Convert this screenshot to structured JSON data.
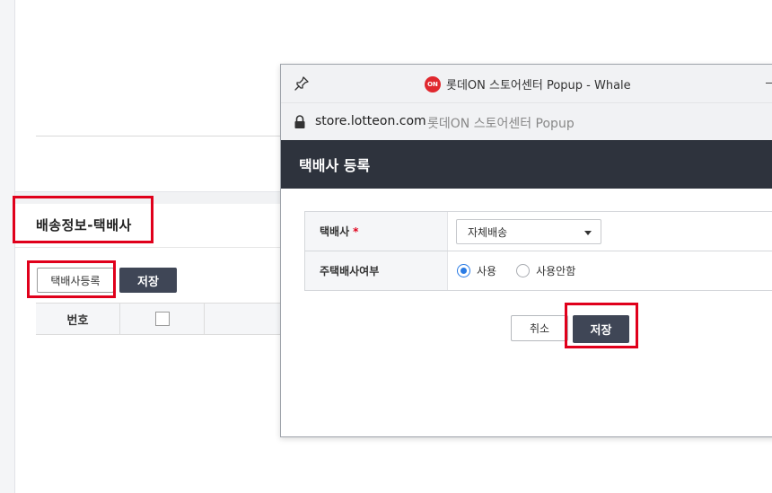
{
  "background": {
    "section_title": "배송정보-택배사",
    "register_button": "택배사등록",
    "save_button": "저장",
    "table_header_number": "번호"
  },
  "popup": {
    "window_title": "롯데ON 스토어센터 Popup - Whale",
    "logo_text": "ON",
    "url_host": "store.lotteon.com",
    "url_page_title": "롯데ON 스토어센터 Popup",
    "dialog_title": "택배사 등록",
    "form": {
      "carrier_label": "택배사",
      "required_mark": "*",
      "carrier_selected": "자체배송",
      "main_carrier_label": "주택배사여부",
      "radio_use": "사용",
      "radio_not_use": "사용안함",
      "radio_selected": "사용"
    },
    "cancel_button": "취소",
    "save_button": "저장"
  },
  "colors": {
    "highlight": "#e0001b",
    "dark_button": "#3f4656",
    "dialog_header": "#2e333d",
    "radio_accent": "#2a7be4",
    "logo": "#e0282e"
  },
  "icons": [
    "pin-icon",
    "lock-icon",
    "caret-down-icon",
    "minimize-icon",
    "checkbox-icon"
  ]
}
